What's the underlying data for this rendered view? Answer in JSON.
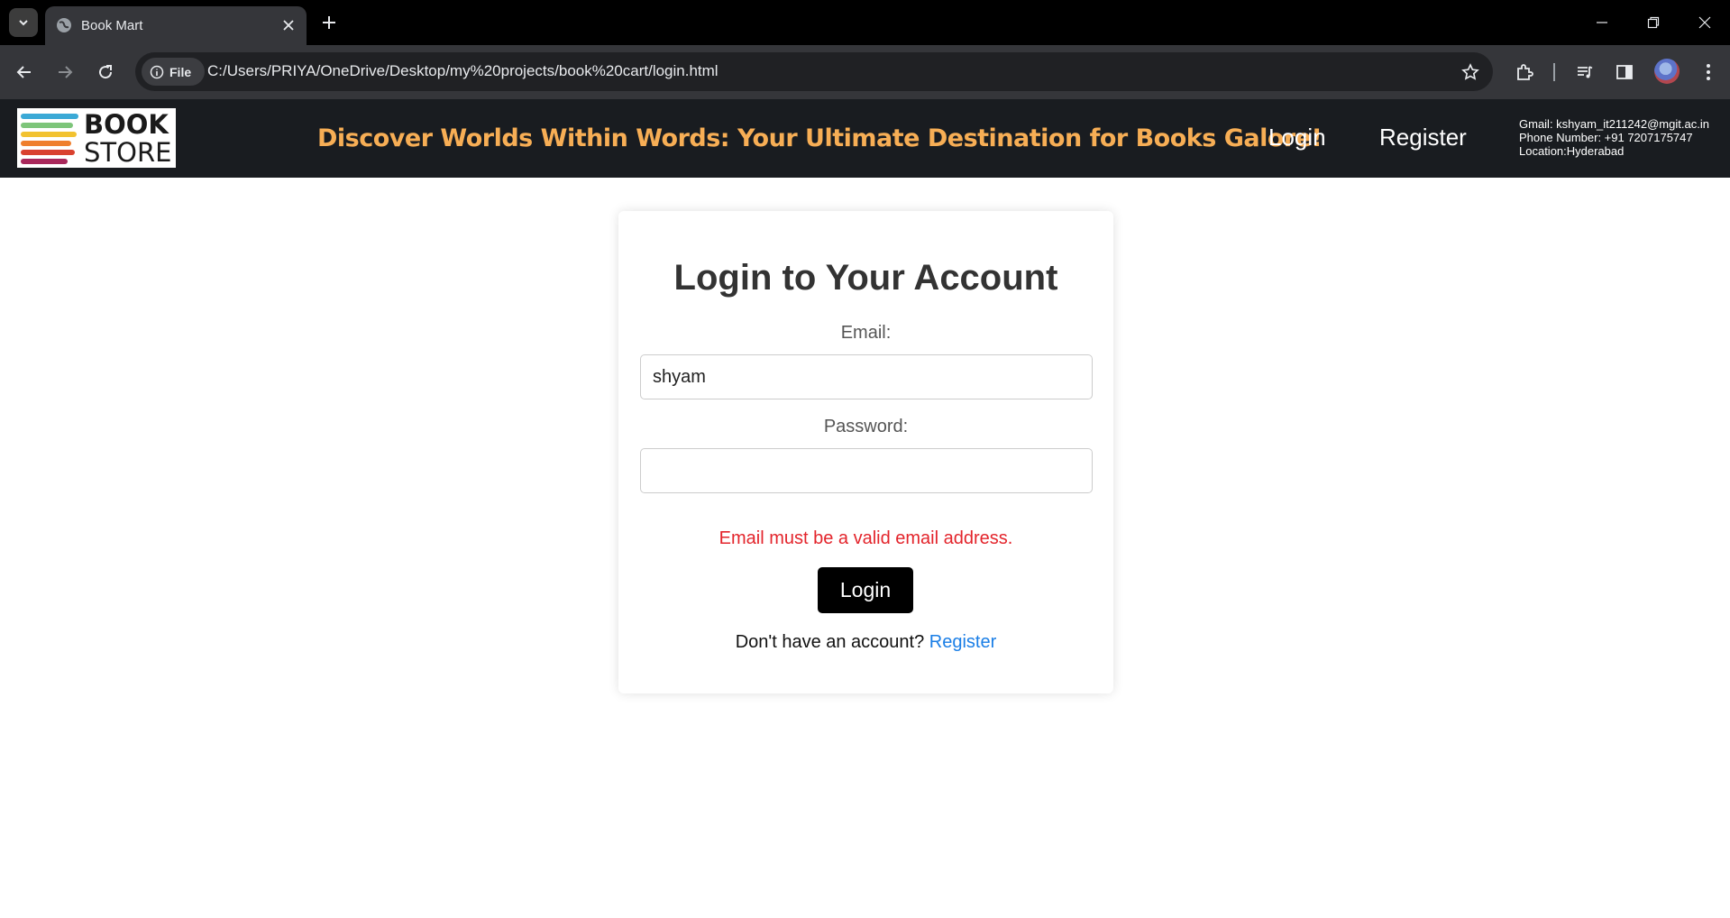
{
  "browser": {
    "tab_title": "Book Mart",
    "site_chip_label": "File",
    "url": "C:/Users/PRIYA/OneDrive/Desktop/my%20projects/book%20cart/login.html"
  },
  "header": {
    "logo_line1": "BOOK",
    "logo_line2": "STORE",
    "tagline": "Discover Worlds Within Words: Your Ultimate Destination for Books Galore!",
    "nav": {
      "login": "Login",
      "register": "Register"
    },
    "contact": {
      "gmail": "Gmail: kshyam_it211242@mgit.ac.in",
      "phone": "Phone Number: +91 7207175747",
      "location": "Location:Hyderabad"
    },
    "logo_stripe_colors": [
      "#3aa9d6",
      "#7dc57a",
      "#f2c230",
      "#ef7f2d",
      "#d9412f",
      "#a8285b"
    ]
  },
  "form": {
    "title": "Login to Your Account",
    "email_label": "Email:",
    "email_value": "shyam",
    "password_label": "Password:",
    "password_value": "",
    "error": "Email must be a valid email address.",
    "login_button": "Login",
    "signup_prompt": "Don't have an account?",
    "signup_link": "Register"
  },
  "colors": {
    "header_bg": "#191c20",
    "tagline": "#f7ae55",
    "error": "#e3242b",
    "link": "#1a7ee6",
    "button_bg": "#000000"
  },
  "icons": [
    "tab-search-icon",
    "globe-icon",
    "close-icon",
    "plus-icon",
    "minimize-icon",
    "restore-icon",
    "back-icon",
    "forward-icon",
    "reload-icon",
    "info-icon",
    "star-icon",
    "extensions-icon",
    "media-icon",
    "sidepanel-icon",
    "menu-icon"
  ]
}
